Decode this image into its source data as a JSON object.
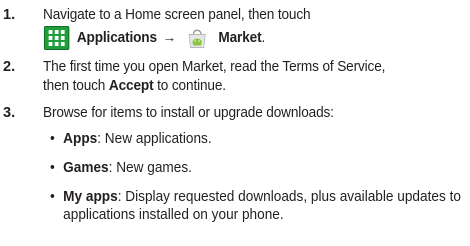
{
  "steps": [
    {
      "number": "1.",
      "line1": "Navigate to a Home screen panel, then touch",
      "applications_label": "Applications",
      "arrow": "→",
      "market_label": "Market",
      "end_punct": "."
    },
    {
      "number": "2.",
      "line1": "The first time you open Market, read the Terms of Service,",
      "line2_pre": "then touch ",
      "accept_label": "Accept",
      "line2_post": " to continue."
    },
    {
      "number": "3.",
      "line1": "Browse for items to install or upgrade downloads:"
    }
  ],
  "bullets": [
    {
      "term": "Apps",
      "desc": ": New applications."
    },
    {
      "term": "Games",
      "desc": ": New games."
    },
    {
      "term": "My apps",
      "desc": ": Display requested downloads, plus available updates to",
      "desc2": "applications installed on your phone."
    }
  ],
  "bullet_glyph": "•",
  "icons": {
    "applications": "applications-grid-icon",
    "market": "market-bag-icon"
  },
  "colors": {
    "text": "#231f20",
    "apps_icon": "#1f9e3c",
    "market_icon": "#8cc63f"
  }
}
